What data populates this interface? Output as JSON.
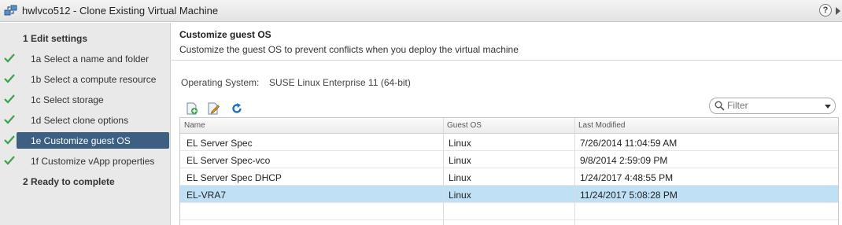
{
  "window": {
    "title": "hwlvco512 - Clone Existing Virtual Machine",
    "help_label": "?"
  },
  "steps": [
    {
      "label": "1  Edit settings",
      "done": false,
      "header": true,
      "active": false
    },
    {
      "label": "1a  Select a name and folder",
      "done": true,
      "header": false,
      "active": false
    },
    {
      "label": "1b  Select a compute resource",
      "done": true,
      "header": false,
      "active": false
    },
    {
      "label": "1c  Select storage",
      "done": true,
      "header": false,
      "active": false
    },
    {
      "label": "1d  Select clone options",
      "done": true,
      "header": false,
      "active": false
    },
    {
      "label": "1e  Customize guest OS",
      "done": true,
      "header": false,
      "active": true
    },
    {
      "label": "1f  Customize vApp properties",
      "done": true,
      "header": false,
      "active": false
    },
    {
      "label": "2  Ready to complete",
      "done": false,
      "header": true,
      "active": false
    }
  ],
  "page": {
    "title": "Customize guest OS",
    "subtitle": "Customize the guest OS to prevent conflicts when you deploy the virtual machine",
    "os_label": "Operating System:",
    "os_value": "SUSE Linux Enterprise 11 (64-bit)"
  },
  "toolbar": {
    "icons": [
      "new-spec-icon",
      "edit-spec-icon",
      "refresh-icon"
    ]
  },
  "filter": {
    "placeholder": "Filter"
  },
  "table": {
    "columns": [
      "Name",
      "Guest OS",
      "Last Modified"
    ],
    "rows": [
      {
        "name": "EL Server Spec",
        "os": "Linux",
        "modified": "7/26/2014 11:04:59 AM",
        "selected": false
      },
      {
        "name": "EL Server Spec-vco",
        "os": "Linux",
        "modified": "9/8/2014 2:59:09 PM",
        "selected": false
      },
      {
        "name": "EL Server Spec DHCP",
        "os": "Linux",
        "modified": "1/24/2017 4:48:55 PM",
        "selected": false
      },
      {
        "name": "EL-VRA7",
        "os": "Linux",
        "modified": "11/24/2017 5:08:28 PM",
        "selected": true
      }
    ]
  },
  "colors": {
    "active_step": "#3d5f82",
    "selected_row": "#bfe0f5",
    "check": "#3aa34a"
  }
}
